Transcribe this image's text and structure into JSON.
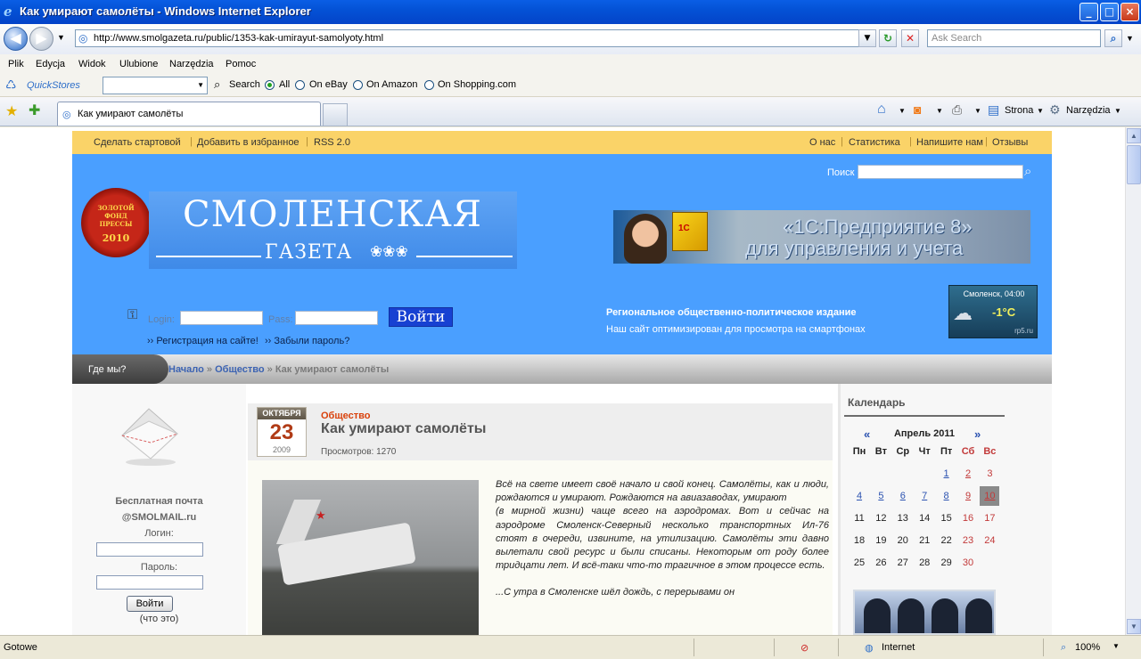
{
  "window": {
    "title": "Как умирают самолёты - Windows Internet Explorer",
    "minimize": "_",
    "maximize": "□",
    "close": "×"
  },
  "address_bar": {
    "url": "http://www.smolgazeta.ru/public/1353-kak-umirayut-samolyoty.html",
    "search_placeholder": "Ask Search"
  },
  "menu": [
    "Plik",
    "Edycja",
    "Widok",
    "Ulubione",
    "Narzędzia",
    "Pomoc"
  ],
  "quickstores": {
    "label": "QuickStores",
    "search_label": "Search",
    "options": [
      "All",
      "On eBay",
      "On Amazon",
      "On Shopping.com"
    ],
    "selected": "All"
  },
  "tabs": {
    "active_title": "Как умирают самолёты",
    "tools": [
      "Strona",
      "Narzędzia"
    ]
  },
  "status_bar": {
    "status": "Gotowe",
    "zone": "Internet",
    "zoom": "100%"
  },
  "site": {
    "top_links_left": [
      "Сделать стартовой",
      "Добавить в избранное",
      "RSS 2.0"
    ],
    "top_links_right": [
      "О нас",
      "Статистика",
      "Напишите нам",
      "Отзывы"
    ],
    "search_label": "Поиск",
    "seal": {
      "line1": "ЗОЛОТОЙ",
      "line2": "ФОНД",
      "line3": "ПРЕССЫ",
      "year": "2010"
    },
    "logo": {
      "title": "СМОЛЕНСКАЯ",
      "subtitle": "ГАЗЕТА"
    },
    "banner": {
      "line1": "«1С:Предприятие 8»",
      "line2": "для управления и учета",
      "box": "1С"
    },
    "login": {
      "login_label": "Login:",
      "pass_label": "Pass:",
      "button": "Войти",
      "register": "Регистрация на сайте!",
      "forgot": "Забыли пароль?"
    },
    "tagline": {
      "line1": "Региональное общественно-политическое издание",
      "line2": "Наш сайт оптимизирован для просмотра на смартфонах"
    },
    "weather": {
      "city_time": "Смоленск, 04:00",
      "temp": "-1°C",
      "source": "rp5.ru"
    },
    "breadcrumb": {
      "where": "Где мы?",
      "home": "Начало",
      "section": "Общество",
      "current": "Как умирают самолёты",
      "sep": "»"
    }
  },
  "left_column": {
    "mail_title": "Бесплатная почта",
    "mail_domain": "@SMOLMAIL.ru",
    "login_label": "Логин:",
    "password_label": "Пароль:",
    "button": "Войти",
    "what": "(что это)"
  },
  "article": {
    "date_month": "ОКТЯБРЯ",
    "date_day": "23",
    "date_year": "2009",
    "category": "Общество",
    "title": "Как умирают самолёты",
    "views": "Просмотров: 1270",
    "paragraphs": [
      "Всё на свете имеет своё начало и свой конец. Самолёты, как и люди, рождаются и умирают. Рождаются на авиазаводах, умирают",
      "(в мирной жизни) чаще всего на аэродромах. Вот и сейчас на аэродроме Смоленск-Северный несколько транспортных Ил-76 стоят в очереди, извините, на утилизацию. Самолёты эти давно вылетали свой ресурс и были списаны. Некоторым от роду более тридцати лет. И всё-таки что-то трагичное в этом процессе есть.",
      "...С утра в Смоленске шёл дождь, с перерывами он"
    ]
  },
  "calendar": {
    "header": "Календарь",
    "month": "Апрель 2011",
    "prev": "«",
    "next": "»",
    "weekdays": [
      "Пн",
      "Вт",
      "Ср",
      "Чт",
      "Пт",
      "Сб",
      "Вс"
    ],
    "weeks": [
      [
        "",
        "",
        "",
        "",
        "1",
        "2",
        "3"
      ],
      [
        "4",
        "5",
        "6",
        "7",
        "8",
        "9",
        "10"
      ],
      [
        "11",
        "12",
        "13",
        "14",
        "15",
        "16",
        "17"
      ],
      [
        "18",
        "19",
        "20",
        "21",
        "22",
        "23",
        "24"
      ],
      [
        "25",
        "26",
        "27",
        "28",
        "29",
        "30",
        ""
      ]
    ],
    "linked_days": [
      "1",
      "2",
      "4",
      "5",
      "6",
      "7",
      "8",
      "9",
      "10"
    ],
    "today": "10"
  }
}
